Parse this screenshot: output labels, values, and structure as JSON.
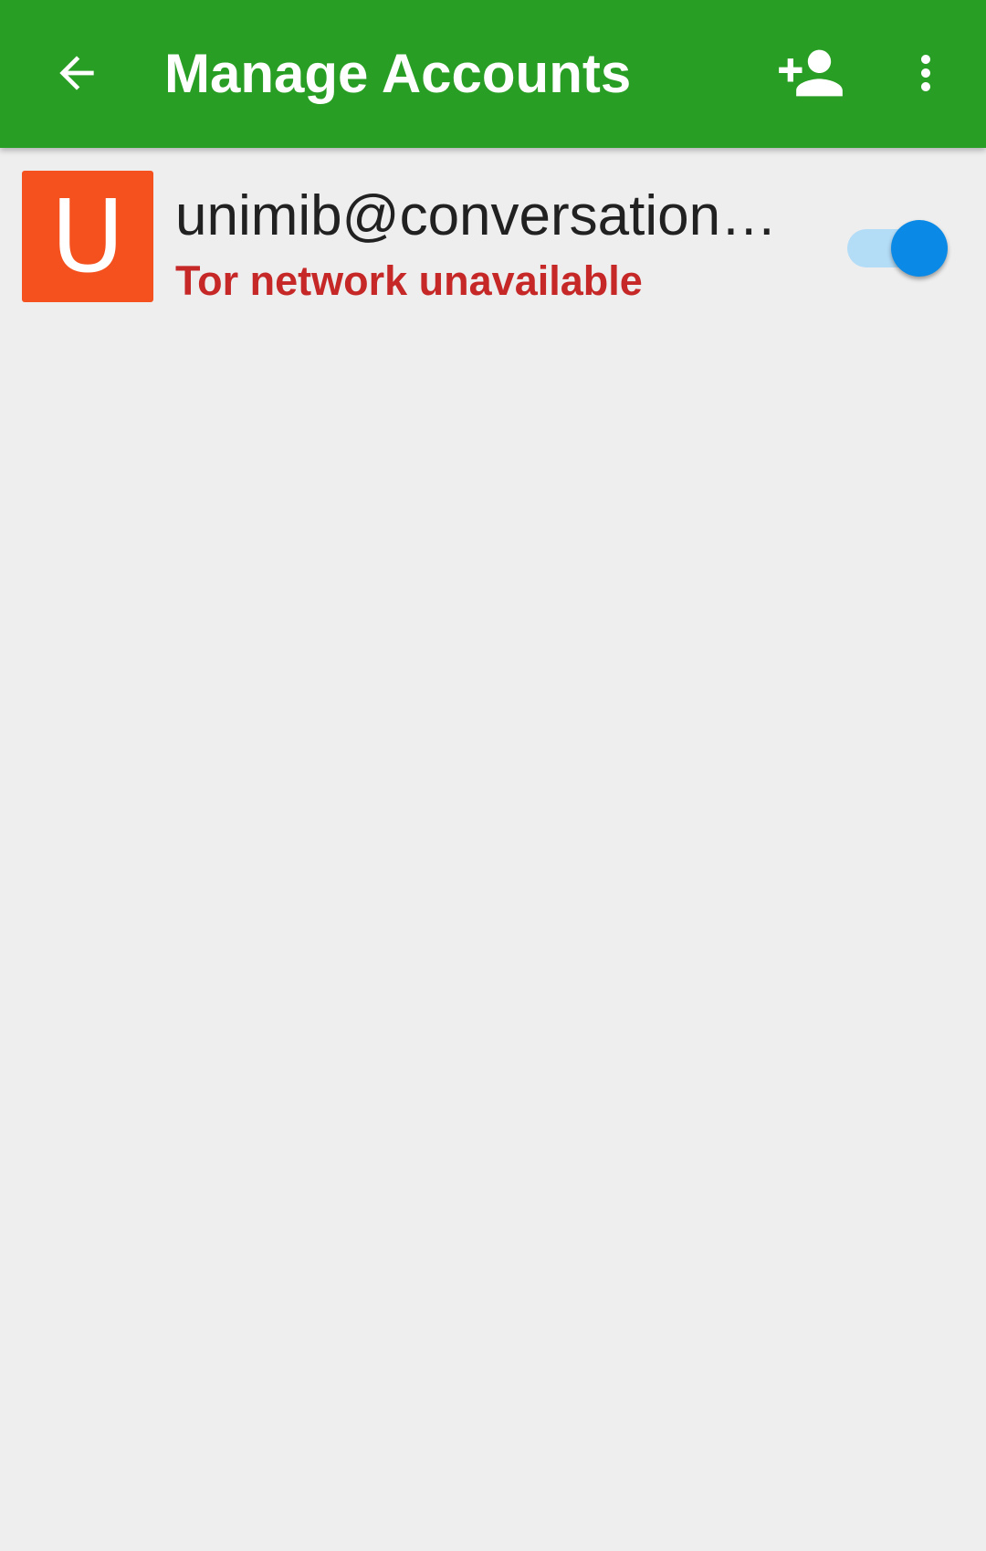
{
  "app_bar": {
    "title": "Manage Accounts",
    "background": "#299e24",
    "back_icon": "arrow-back-icon",
    "add_icon": "person-add-icon",
    "more_icon": "more-vert-icon"
  },
  "accounts": [
    {
      "avatar_letter": "U",
      "avatar_color": "#f4511e",
      "jid": "unimib@conversations.im",
      "status": "Tor network unavailable",
      "status_color": "#c62828",
      "enabled": true,
      "toggle_color": "#0a8ae6"
    }
  ]
}
